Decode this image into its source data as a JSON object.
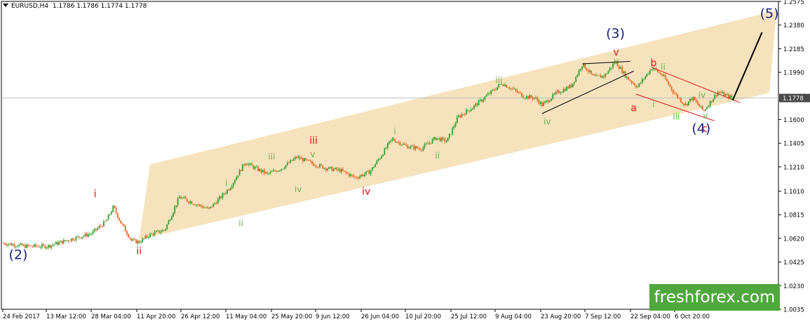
{
  "header": {
    "symbol": "EURUSD,H4",
    "ohlc": "1.1786 1.1786 1.1774 1.1778"
  },
  "brand": {
    "text": "freshforex.com",
    "color": "#4fa83d"
  },
  "colors": {
    "channel": "#f5deb3",
    "bull_candle": "#2e9e2e",
    "bear_candle": "#e8641e",
    "wave_primary": "#1a237e",
    "wave_red": "#e01010",
    "wave_green": "#6ab04c",
    "grid": "#c0c0c0",
    "current_price_label_bg": "#4a4a4a"
  },
  "chart_data": {
    "type": "candlestick",
    "title": "",
    "symbol": "EURUSD",
    "timeframe": "H4",
    "grid": false,
    "y_axis": {
      "side": "right",
      "range": [
        1.0035,
        1.2575
      ],
      "ticks": [
        "1.2575",
        "1.2380",
        "1.2185",
        "1.1990",
        "1.1778",
        "1.1600",
        "1.1405",
        "1.1210",
        "1.1010",
        "1.0815",
        "1.0620",
        "1.0425",
        "1.0230",
        "1.0035"
      ],
      "current_price": "1.1778"
    },
    "x_axis": {
      "ticks": [
        "24 Feb 2017",
        "13 Mar 12:00",
        "28 Mar 04:00",
        "11 Apr 20:00",
        "26 Apr 12:00",
        "11 May 04:00",
        "25 May 20:00",
        "9 Jun 12:00",
        "26 Jun 04:00",
        "10 Jul 20:00",
        "25 Jul 12:00",
        "9 Aug 04:00",
        "23 Aug 20:00",
        "7 Sep 12:00",
        "22 Sep 04:00",
        "6 Oct 20:00"
      ]
    },
    "price_path": [
      [
        0,
        1.058
      ],
      [
        3,
        1.0555
      ],
      [
        6,
        1.0555
      ],
      [
        9,
        1.061
      ],
      [
        12,
        1.066
      ],
      [
        14,
        1.076
      ],
      [
        15,
        1.088
      ],
      [
        16,
        1.075
      ],
      [
        17.5,
        1.06
      ],
      [
        18.5,
        1.059
      ],
      [
        20,
        1.065
      ],
      [
        22,
        1.069
      ],
      [
        24,
        1.096
      ],
      [
        26,
        1.091
      ],
      [
        28,
        1.086
      ],
      [
        29.5,
        1.095
      ],
      [
        31,
        1.105
      ],
      [
        33,
        1.125
      ],
      [
        34,
        1.121
      ],
      [
        36,
        1.115
      ],
      [
        38,
        1.12
      ],
      [
        40,
        1.129
      ],
      [
        42,
        1.124
      ],
      [
        44,
        1.12
      ],
      [
        46,
        1.118
      ],
      [
        48,
        1.112
      ],
      [
        50,
        1.117
      ],
      [
        51.5,
        1.13
      ],
      [
        53,
        1.144
      ],
      [
        55,
        1.138
      ],
      [
        57,
        1.136
      ],
      [
        59,
        1.145
      ],
      [
        60.5,
        1.142
      ],
      [
        62,
        1.162
      ],
      [
        64,
        1.17
      ],
      [
        66,
        1.18
      ],
      [
        68,
        1.19
      ],
      [
        69.5,
        1.185
      ],
      [
        71,
        1.179
      ],
      [
        72.5,
        1.178
      ],
      [
        73.5,
        1.172
      ],
      [
        75.5,
        1.182
      ],
      [
        77.5,
        1.188
      ],
      [
        79,
        1.206
      ],
      [
        80.5,
        1.195
      ],
      [
        82,
        1.196
      ],
      [
        83.5,
        1.208
      ],
      [
        85,
        1.195
      ],
      [
        86.5,
        1.187
      ],
      [
        88.5,
        1.203
      ],
      [
        90,
        1.196
      ],
      [
        91.5,
        1.182
      ],
      [
        93,
        1.172
      ],
      [
        94,
        1.178
      ],
      [
        95.5,
        1.167
      ],
      [
        97.5,
        1.183
      ],
      [
        98.5,
        1.18
      ],
      [
        99.5,
        1.1778
      ]
    ],
    "projection": [
      [
        99.5,
        1.176
      ],
      [
        103.5,
        1.232
      ]
    ],
    "wave_labels": [
      {
        "text": "(2)",
        "group": "primary",
        "x": 2,
        "y": 1.045
      },
      {
        "text": "(3)",
        "group": "primary",
        "x": 83.5,
        "y": 1.2275
      },
      {
        "text": "(4)",
        "group": "primary",
        "x": 95.2,
        "y": 1.149
      },
      {
        "text": "(5)",
        "group": "primary",
        "x": 104.5,
        "y": 1.244
      },
      {
        "text": "i",
        "group": "red",
        "x": 12.5,
        "y": 1.096
      },
      {
        "text": "ii",
        "group": "red",
        "x": 18.5,
        "y": 1.049
      },
      {
        "text": "iii",
        "group": "red",
        "x": 42.3,
        "y": 1.14
      },
      {
        "text": "iv",
        "group": "red",
        "x": 49.5,
        "y": 1.098
      },
      {
        "text": "v",
        "group": "red",
        "x": 83.6,
        "y": 1.213
      },
      {
        "text": "a",
        "group": "red",
        "x": 86,
        "y": 1.167
      },
      {
        "text": "b",
        "group": "red",
        "x": 88.7,
        "y": 1.204
      },
      {
        "text": "c",
        "group": "red",
        "x": 95.7,
        "y": 1.15
      },
      {
        "text": "i",
        "group": "green",
        "x": 30.4,
        "y": 1.105
      },
      {
        "text": "ii",
        "group": "green",
        "x": 32.4,
        "y": 1.072
      },
      {
        "text": "iii",
        "group": "green",
        "x": 36.6,
        "y": 1.127
      },
      {
        "text": "iv",
        "group": "green",
        "x": 40.2,
        "y": 1.1
      },
      {
        "text": "v",
        "group": "green",
        "x": 42.2,
        "y": 1.129
      },
      {
        "text": "i",
        "group": "green",
        "x": 53.4,
        "y": 1.148
      },
      {
        "text": "ii",
        "group": "green",
        "x": 59.2,
        "y": 1.128
      },
      {
        "text": "iii",
        "group": "green",
        "x": 67.6,
        "y": 1.19
      },
      {
        "text": "iv",
        "group": "green",
        "x": 74.2,
        "y": 1.156
      },
      {
        "text": "v",
        "group": "green",
        "x": 83.6,
        "y": 1.206
      },
      {
        "text": "ii",
        "group": "green",
        "x": 90,
        "y": 1.201
      },
      {
        "text": "i",
        "group": "green",
        "x": 88.7,
        "y": 1.17
      },
      {
        "text": "iii",
        "group": "green",
        "x": 91.8,
        "y": 1.16
      },
      {
        "text": "iv",
        "group": "green",
        "x": 95.3,
        "y": 1.178
      },
      {
        "text": "v",
        "group": "green",
        "x": 95.8,
        "y": 1.161
      }
    ],
    "channel": {
      "lower": [
        [
          18.5,
          1.061
        ],
        [
          104.5,
          1.182
        ]
      ],
      "upper": [
        [
          20,
          1.123
        ],
        [
          105.5,
          1.25
        ]
      ]
    },
    "triangle_lines": [
      [
        [
          73.5,
          1.165
        ],
        [
          86,
          1.2
        ]
      ],
      [
        [
          79,
          1.206
        ],
        [
          85.5,
          1.208
        ]
      ]
    ],
    "wedge_lines": [
      [
        [
          88.5,
          1.203
        ],
        [
          100.5,
          1.174
        ]
      ],
      [
        [
          86.3,
          1.181
        ],
        [
          97,
          1.159
        ]
      ]
    ]
  }
}
